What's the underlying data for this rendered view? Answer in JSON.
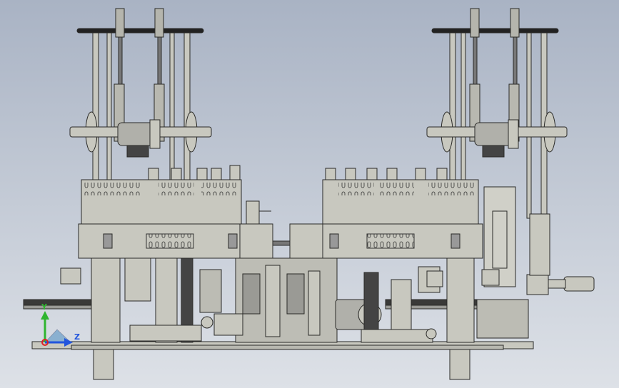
{
  "viewport": {
    "background_top": "#a9b3c4",
    "background_bottom": "#dde1e7"
  },
  "model": {
    "body_color": "#c8c8bf",
    "dark_color": "#5a5a55",
    "line_color": "#2a2a28",
    "motor_color": "#b0b0aa"
  },
  "triad": {
    "y_label": "Y",
    "z_label": "Z",
    "y_color": "#2fb52f",
    "z_color": "#2255dd",
    "x_color": "#dd2222"
  }
}
